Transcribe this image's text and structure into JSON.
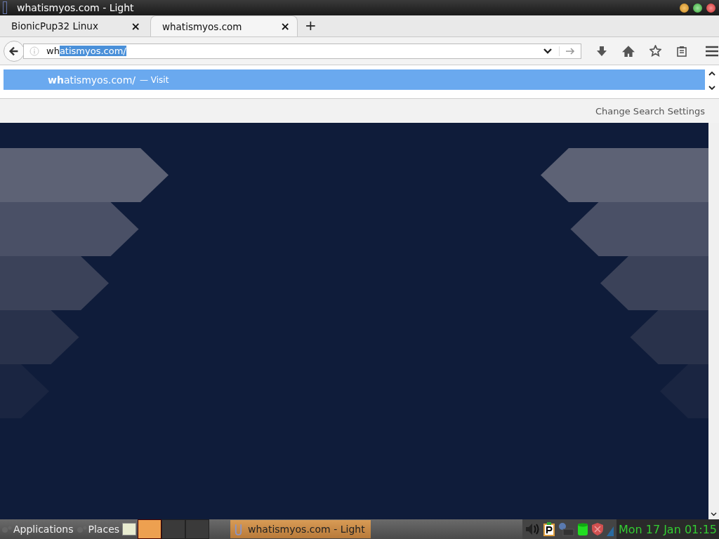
{
  "window": {
    "title": "whatismyos.com - Light"
  },
  "tabs": [
    {
      "label": "BionicPup32 Linux",
      "close": "×",
      "selected": false
    },
    {
      "label": "whatismyos.com",
      "close": "×",
      "selected": true
    }
  ],
  "new_tab": "+",
  "url_field": {
    "typed": "wh",
    "autofilled": "atismyos.com/"
  },
  "suggestions": [
    {
      "text": "**wh**atismyos.com/",
      "action": "— Visit",
      "selected": true
    }
  ],
  "search_settings": "Change Search Settings",
  "taskbar": {
    "menus": [
      "Applications",
      "Places"
    ],
    "workspaces": [
      {
        "selected": true
      },
      {
        "selected": false
      },
      {
        "selected": false
      }
    ],
    "tasks": [
      {
        "label": "whatismyos.com - Light",
        "selected": true
      }
    ],
    "clock": "Mon 17 Jan 01:15"
  }
}
